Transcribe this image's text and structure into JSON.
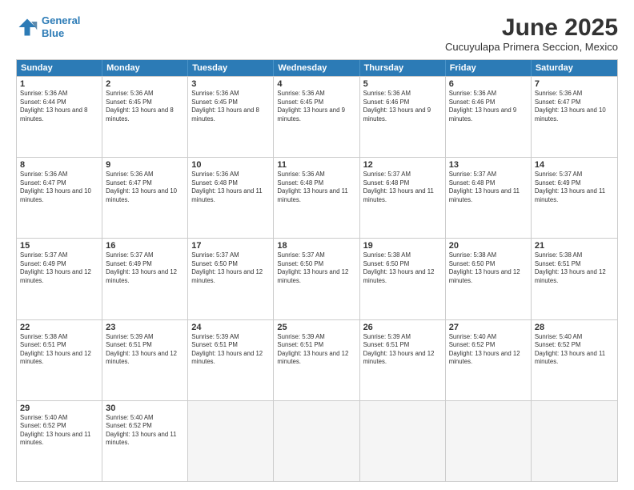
{
  "header": {
    "logo_line1": "General",
    "logo_line2": "Blue",
    "title": "June 2025",
    "subtitle": "Cucuyulapa Primera Seccion, Mexico"
  },
  "weekdays": [
    "Sunday",
    "Monday",
    "Tuesday",
    "Wednesday",
    "Thursday",
    "Friday",
    "Saturday"
  ],
  "weeks": [
    [
      {
        "day": "1",
        "rise": "5:36 AM",
        "set": "6:44 PM",
        "daylight": "13 hours and 8 minutes."
      },
      {
        "day": "2",
        "rise": "5:36 AM",
        "set": "6:45 PM",
        "daylight": "13 hours and 8 minutes."
      },
      {
        "day": "3",
        "rise": "5:36 AM",
        "set": "6:45 PM",
        "daylight": "13 hours and 8 minutes."
      },
      {
        "day": "4",
        "rise": "5:36 AM",
        "set": "6:45 PM",
        "daylight": "13 hours and 9 minutes."
      },
      {
        "day": "5",
        "rise": "5:36 AM",
        "set": "6:46 PM",
        "daylight": "13 hours and 9 minutes."
      },
      {
        "day": "6",
        "rise": "5:36 AM",
        "set": "6:46 PM",
        "daylight": "13 hours and 9 minutes."
      },
      {
        "day": "7",
        "rise": "5:36 AM",
        "set": "6:47 PM",
        "daylight": "13 hours and 10 minutes."
      }
    ],
    [
      {
        "day": "8",
        "rise": "5:36 AM",
        "set": "6:47 PM",
        "daylight": "13 hours and 10 minutes."
      },
      {
        "day": "9",
        "rise": "5:36 AM",
        "set": "6:47 PM",
        "daylight": "13 hours and 10 minutes."
      },
      {
        "day": "10",
        "rise": "5:36 AM",
        "set": "6:48 PM",
        "daylight": "13 hours and 11 minutes."
      },
      {
        "day": "11",
        "rise": "5:36 AM",
        "set": "6:48 PM",
        "daylight": "13 hours and 11 minutes."
      },
      {
        "day": "12",
        "rise": "5:37 AM",
        "set": "6:48 PM",
        "daylight": "13 hours and 11 minutes."
      },
      {
        "day": "13",
        "rise": "5:37 AM",
        "set": "6:48 PM",
        "daylight": "13 hours and 11 minutes."
      },
      {
        "day": "14",
        "rise": "5:37 AM",
        "set": "6:49 PM",
        "daylight": "13 hours and 11 minutes."
      }
    ],
    [
      {
        "day": "15",
        "rise": "5:37 AM",
        "set": "6:49 PM",
        "daylight": "13 hours and 12 minutes."
      },
      {
        "day": "16",
        "rise": "5:37 AM",
        "set": "6:49 PM",
        "daylight": "13 hours and 12 minutes."
      },
      {
        "day": "17",
        "rise": "5:37 AM",
        "set": "6:50 PM",
        "daylight": "13 hours and 12 minutes."
      },
      {
        "day": "18",
        "rise": "5:37 AM",
        "set": "6:50 PM",
        "daylight": "13 hours and 12 minutes."
      },
      {
        "day": "19",
        "rise": "5:38 AM",
        "set": "6:50 PM",
        "daylight": "13 hours and 12 minutes."
      },
      {
        "day": "20",
        "rise": "5:38 AM",
        "set": "6:50 PM",
        "daylight": "13 hours and 12 minutes."
      },
      {
        "day": "21",
        "rise": "5:38 AM",
        "set": "6:51 PM",
        "daylight": "13 hours and 12 minutes."
      }
    ],
    [
      {
        "day": "22",
        "rise": "5:38 AM",
        "set": "6:51 PM",
        "daylight": "13 hours and 12 minutes."
      },
      {
        "day": "23",
        "rise": "5:39 AM",
        "set": "6:51 PM",
        "daylight": "13 hours and 12 minutes."
      },
      {
        "day": "24",
        "rise": "5:39 AM",
        "set": "6:51 PM",
        "daylight": "13 hours and 12 minutes."
      },
      {
        "day": "25",
        "rise": "5:39 AM",
        "set": "6:51 PM",
        "daylight": "13 hours and 12 minutes."
      },
      {
        "day": "26",
        "rise": "5:39 AM",
        "set": "6:51 PM",
        "daylight": "13 hours and 12 minutes."
      },
      {
        "day": "27",
        "rise": "5:40 AM",
        "set": "6:52 PM",
        "daylight": "13 hours and 12 minutes."
      },
      {
        "day": "28",
        "rise": "5:40 AM",
        "set": "6:52 PM",
        "daylight": "13 hours and 11 minutes."
      }
    ],
    [
      {
        "day": "29",
        "rise": "5:40 AM",
        "set": "6:52 PM",
        "daylight": "13 hours and 11 minutes."
      },
      {
        "day": "30",
        "rise": "5:40 AM",
        "set": "6:52 PM",
        "daylight": "13 hours and 11 minutes."
      },
      null,
      null,
      null,
      null,
      null
    ]
  ]
}
